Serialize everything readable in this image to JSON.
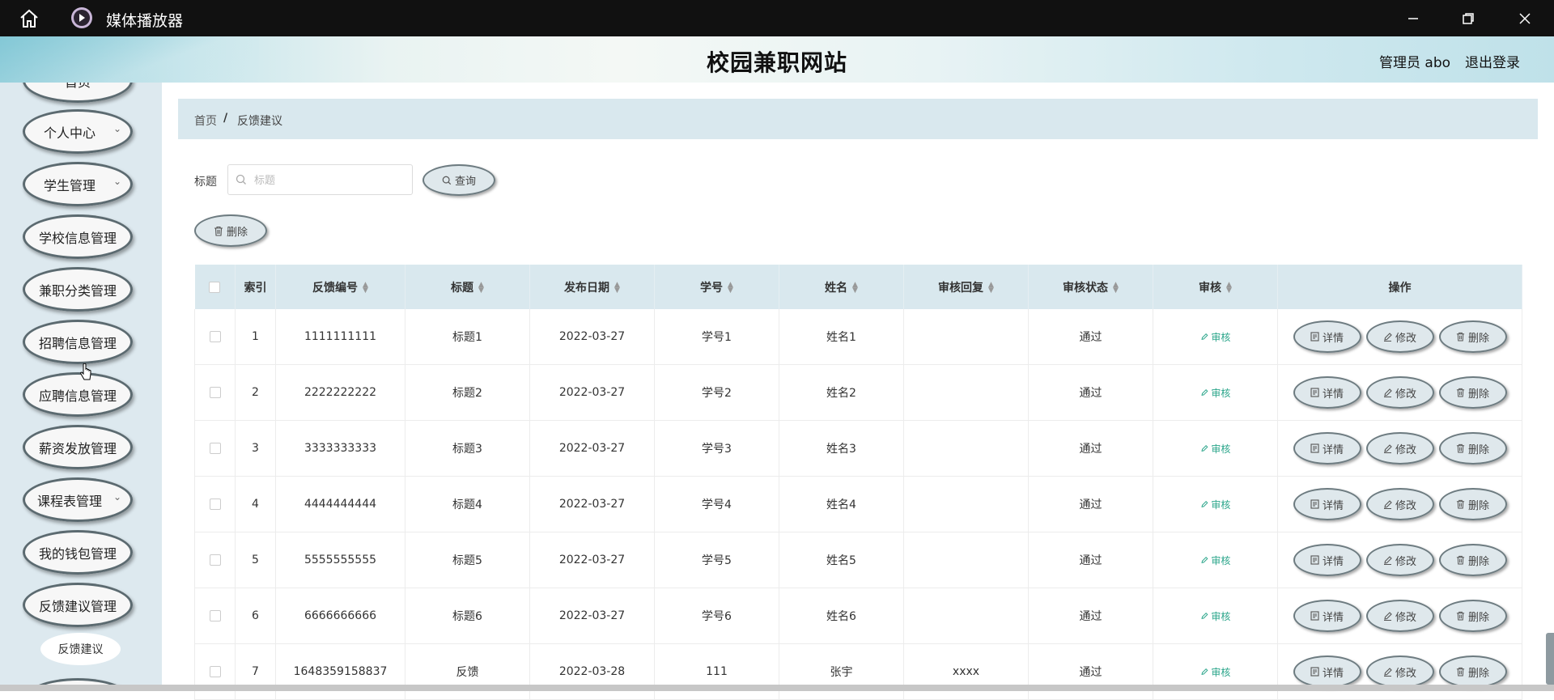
{
  "window": {
    "title": "媒体播放器"
  },
  "header": {
    "site_title": "校园兼职网站",
    "user": "管理员 abo",
    "logout": "退出登录"
  },
  "sidebar": {
    "items": [
      {
        "label": "首页",
        "chevron": false
      },
      {
        "label": "个人中心",
        "chevron": true
      },
      {
        "label": "学生管理",
        "chevron": true
      },
      {
        "label": "学校信息管理",
        "chevron": false
      },
      {
        "label": "兼职分类管理",
        "chevron": false
      },
      {
        "label": "招聘信息管理",
        "chevron": false
      },
      {
        "label": "应聘信息管理",
        "chevron": false
      },
      {
        "label": "薪资发放管理",
        "chevron": false
      },
      {
        "label": "课程表管理",
        "chevron": true
      },
      {
        "label": "我的钱包管理",
        "chevron": false
      },
      {
        "label": "反馈建议管理",
        "chevron": false
      }
    ],
    "sub_item": "反馈建议"
  },
  "breadcrumb": {
    "home": "首页",
    "separator": "/",
    "current": "反馈建议"
  },
  "search": {
    "label": "标题",
    "placeholder": "标题",
    "query_button": "查询"
  },
  "toolbar": {
    "delete_button": "删除"
  },
  "table": {
    "headers": {
      "index": "索引",
      "feedback_no": "反馈编号",
      "title": "标题",
      "date": "发布日期",
      "student_no": "学号",
      "name": "姓名",
      "reply": "审核回复",
      "status": "审核状态",
      "audit": "审核",
      "ops": "操作"
    },
    "audit_link": "审核",
    "row_buttons": {
      "detail": "详情",
      "edit": "修改",
      "delete": "删除"
    },
    "rows": [
      {
        "index": "1",
        "feedback_no": "1111111111",
        "title": "标题1",
        "date": "2022-03-27",
        "student_no": "学号1",
        "name": "姓名1",
        "reply": "",
        "status": "通过"
      },
      {
        "index": "2",
        "feedback_no": "2222222222",
        "title": "标题2",
        "date": "2022-03-27",
        "student_no": "学号2",
        "name": "姓名2",
        "reply": "",
        "status": "通过"
      },
      {
        "index": "3",
        "feedback_no": "3333333333",
        "title": "标题3",
        "date": "2022-03-27",
        "student_no": "学号3",
        "name": "姓名3",
        "reply": "",
        "status": "通过"
      },
      {
        "index": "4",
        "feedback_no": "4444444444",
        "title": "标题4",
        "date": "2022-03-27",
        "student_no": "学号4",
        "name": "姓名4",
        "reply": "",
        "status": "通过"
      },
      {
        "index": "5",
        "feedback_no": "5555555555",
        "title": "标题5",
        "date": "2022-03-27",
        "student_no": "学号5",
        "name": "姓名5",
        "reply": "",
        "status": "通过"
      },
      {
        "index": "6",
        "feedback_no": "6666666666",
        "title": "标题6",
        "date": "2022-03-27",
        "student_no": "学号6",
        "name": "姓名6",
        "reply": "",
        "status": "通过"
      },
      {
        "index": "7",
        "feedback_no": "1648359158837",
        "title": "反馈",
        "date": "2022-03-28",
        "student_no": "111",
        "name": "张宇",
        "reply": "xxxx",
        "status": "通过"
      }
    ]
  },
  "colors": {
    "accent": "#2aa58a",
    "header_bg": "#d9e8ee",
    "sidebar_bg": "#dde9ef"
  }
}
